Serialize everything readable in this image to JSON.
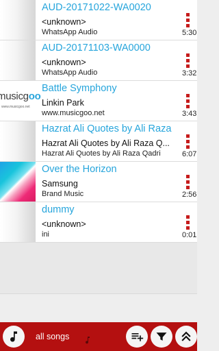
{
  "songs": [
    {
      "title": "AUD-20171022-WA0020",
      "artist": "<unknown>",
      "album": "WhatsApp Audio",
      "duration": "5:30",
      "art": "blank"
    },
    {
      "title": "AUD-20171103-WA0000",
      "artist": "<unknown>",
      "album": "WhatsApp Audio",
      "duration": "3:32",
      "art": "blank"
    },
    {
      "title": "Battle Symphony",
      "artist": "Linkin Park",
      "album": "www.musicgoo.net",
      "duration": "3:43",
      "art": "musicgoo",
      "art_text": "musicgoo",
      "art_url": "www.musicgoo.net"
    },
    {
      "title": "Hazrat Ali Quotes by Ali Raza",
      "artist": "Hazrat Ali Quotes by Ali Raza Q...",
      "album": "Hazrat Ali Quotes by Ali Raza Qadri",
      "duration": "6:07",
      "art": "blank"
    },
    {
      "title": "Over the Horizon",
      "artist": "Samsung",
      "album": "Brand Music",
      "duration": "2:56",
      "art": "samsung"
    },
    {
      "title": "dummy",
      "artist": "<unknown>",
      "album": "ini",
      "duration": "0:01",
      "art": "blank"
    }
  ],
  "bottom_bar": {
    "label": "all songs",
    "icons": [
      "music-note-icon",
      "playlist-add-icon",
      "filter-icon",
      "scroll-top-icon"
    ]
  },
  "colors": {
    "accent": "#b41010",
    "title": "#26a5dc",
    "menu": "#c61c1c"
  }
}
